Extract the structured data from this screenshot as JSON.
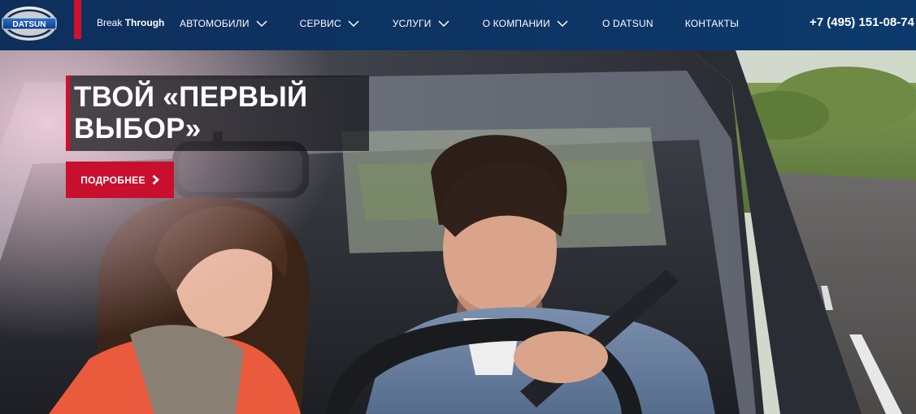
{
  "brand": {
    "logo_text": "DATSUN",
    "tagline_regular": "Break",
    "tagline_bold": "Through"
  },
  "nav": {
    "items": [
      {
        "label": "АВТОМОБИЛИ",
        "has_dropdown": true
      },
      {
        "label": "СЕРВИС",
        "has_dropdown": true
      },
      {
        "label": "УСЛУГИ",
        "has_dropdown": true
      },
      {
        "label": "О КОМПАНИИ",
        "has_dropdown": true
      },
      {
        "label": "О DATSUN",
        "has_dropdown": false
      },
      {
        "label": "КОНТАКТЫ",
        "has_dropdown": false
      }
    ]
  },
  "phone": "+7 (495) 151-08-74",
  "hero": {
    "headline_line1": "ТВОЙ «ПЕРВЫЙ",
    "headline_line2": "ВЫБОР»",
    "cta_label": "ПОДРОБНЕЕ"
  },
  "colors": {
    "header_bg": "#0e2f5c",
    "accent_red": "#d10f2e",
    "text_white": "#ffffff"
  },
  "icons": {
    "dropdown": "chevron-down-icon",
    "cta": "chevron-right-icon"
  }
}
